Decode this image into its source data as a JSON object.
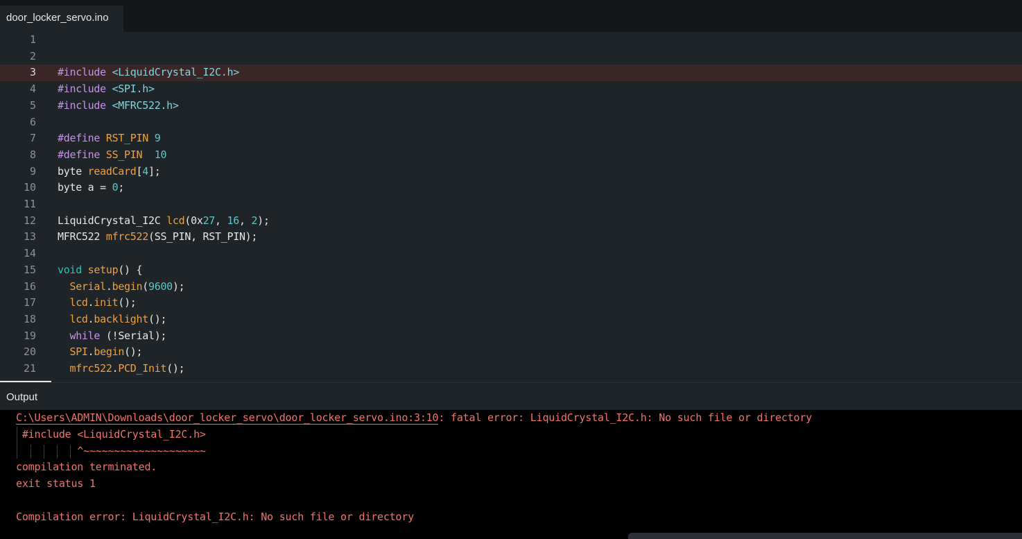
{
  "tab": {
    "filename": "door_locker_servo.ino"
  },
  "editor": {
    "highlighted_line": 3,
    "lines": [
      {
        "n": "1",
        "segments": []
      },
      {
        "n": "2",
        "segments": []
      },
      {
        "n": "3",
        "segments": [
          {
            "t": "#include ",
            "c": "pre"
          },
          {
            "t": "<LiquidCrystal_I2C.h>",
            "c": "inc"
          }
        ]
      },
      {
        "n": "4",
        "segments": [
          {
            "t": "#include ",
            "c": "pre"
          },
          {
            "t": "<SPI.h>",
            "c": "inc"
          }
        ]
      },
      {
        "n": "5",
        "segments": [
          {
            "t": "#include ",
            "c": "pre"
          },
          {
            "t": "<MFRC522.h>",
            "c": "inc"
          }
        ]
      },
      {
        "n": "6",
        "segments": []
      },
      {
        "n": "7",
        "segments": [
          {
            "t": "#define ",
            "c": "pre"
          },
          {
            "t": "RST_PIN ",
            "c": "fn"
          },
          {
            "t": "9",
            "c": "num"
          }
        ]
      },
      {
        "n": "8",
        "segments": [
          {
            "t": "#define ",
            "c": "pre"
          },
          {
            "t": "SS_PIN  ",
            "c": "fn"
          },
          {
            "t": "10",
            "c": "num"
          }
        ]
      },
      {
        "n": "9",
        "segments": [
          {
            "t": "byte ",
            "c": "def"
          },
          {
            "t": "readCard",
            "c": "fn"
          },
          {
            "t": "[",
            "c": "def"
          },
          {
            "t": "4",
            "c": "num"
          },
          {
            "t": "];",
            "c": "def"
          }
        ]
      },
      {
        "n": "10",
        "segments": [
          {
            "t": "byte a = ",
            "c": "def"
          },
          {
            "t": "0",
            "c": "num"
          },
          {
            "t": ";",
            "c": "def"
          }
        ]
      },
      {
        "n": "11",
        "segments": []
      },
      {
        "n": "12",
        "segments": [
          {
            "t": "LiquidCrystal_I2C ",
            "c": "def"
          },
          {
            "t": "lcd",
            "c": "fn"
          },
          {
            "t": "(0x",
            "c": "def"
          },
          {
            "t": "27",
            "c": "num"
          },
          {
            "t": ", ",
            "c": "def"
          },
          {
            "t": "16",
            "c": "num"
          },
          {
            "t": ", ",
            "c": "def"
          },
          {
            "t": "2",
            "c": "num"
          },
          {
            "t": ");",
            "c": "def"
          }
        ]
      },
      {
        "n": "13",
        "segments": [
          {
            "t": "MFRC522 ",
            "c": "def"
          },
          {
            "t": "mfrc522",
            "c": "fn"
          },
          {
            "t": "(SS_PIN, RST_PIN);",
            "c": "def"
          }
        ]
      },
      {
        "n": "14",
        "segments": []
      },
      {
        "n": "15",
        "segments": [
          {
            "t": "void ",
            "c": "void"
          },
          {
            "t": "setup",
            "c": "fn"
          },
          {
            "t": "() {",
            "c": "def"
          }
        ]
      },
      {
        "n": "16",
        "segments": [
          {
            "t": "  ",
            "c": "def"
          },
          {
            "t": "Serial",
            "c": "fn"
          },
          {
            "t": ".",
            "c": "def"
          },
          {
            "t": "begin",
            "c": "fn"
          },
          {
            "t": "(",
            "c": "def"
          },
          {
            "t": "9600",
            "c": "num"
          },
          {
            "t": ");",
            "c": "def"
          }
        ]
      },
      {
        "n": "17",
        "segments": [
          {
            "t": "  ",
            "c": "def"
          },
          {
            "t": "lcd",
            "c": "fn"
          },
          {
            "t": ".",
            "c": "def"
          },
          {
            "t": "init",
            "c": "fn"
          },
          {
            "t": "();",
            "c": "def"
          }
        ]
      },
      {
        "n": "18",
        "segments": [
          {
            "t": "  ",
            "c": "def"
          },
          {
            "t": "lcd",
            "c": "fn"
          },
          {
            "t": ".",
            "c": "def"
          },
          {
            "t": "backlight",
            "c": "fn"
          },
          {
            "t": "();",
            "c": "def"
          }
        ]
      },
      {
        "n": "19",
        "segments": [
          {
            "t": "  ",
            "c": "def"
          },
          {
            "t": "while",
            "c": "kw"
          },
          {
            "t": " (!Serial);",
            "c": "def"
          }
        ]
      },
      {
        "n": "20",
        "segments": [
          {
            "t": "  ",
            "c": "def"
          },
          {
            "t": "SPI",
            "c": "fn"
          },
          {
            "t": ".",
            "c": "def"
          },
          {
            "t": "begin",
            "c": "fn"
          },
          {
            "t": "();",
            "c": "def"
          }
        ]
      },
      {
        "n": "21",
        "segments": [
          {
            "t": "  ",
            "c": "def"
          },
          {
            "t": "mfrc522",
            "c": "fn"
          },
          {
            "t": ".",
            "c": "def"
          },
          {
            "t": "PCD_Init",
            "c": "fn"
          },
          {
            "t": "();",
            "c": "def"
          }
        ]
      }
    ]
  },
  "output": {
    "title": "Output",
    "error_path": "C:\\Users\\ADMIN\\Downloads\\door_locker_servo\\door_locker_servo.ino:3:10",
    "error_message": ": fatal error: LiquidCrystal_I2C.h: No such file or directory",
    "source_line": " #include <LiquidCrystal_I2C.h>",
    "caret_line": "          ^~~~~~~~~~~~~~~~~~~~~",
    "terminated": "compilation terminated.",
    "exit_status": "exit status 1",
    "compilation_error": "Compilation error: LiquidCrystal_I2C.h: No such file or directory"
  },
  "colors": {
    "editor_bg": "#1f2428",
    "highlight_bg": "#3a2627",
    "output_bg": "#000000",
    "error_text": "#f0746a",
    "preprocessor": "#c792ea",
    "include_path": "#7fd6e0",
    "identifier": "#f0a040",
    "number": "#5cc7c9"
  }
}
